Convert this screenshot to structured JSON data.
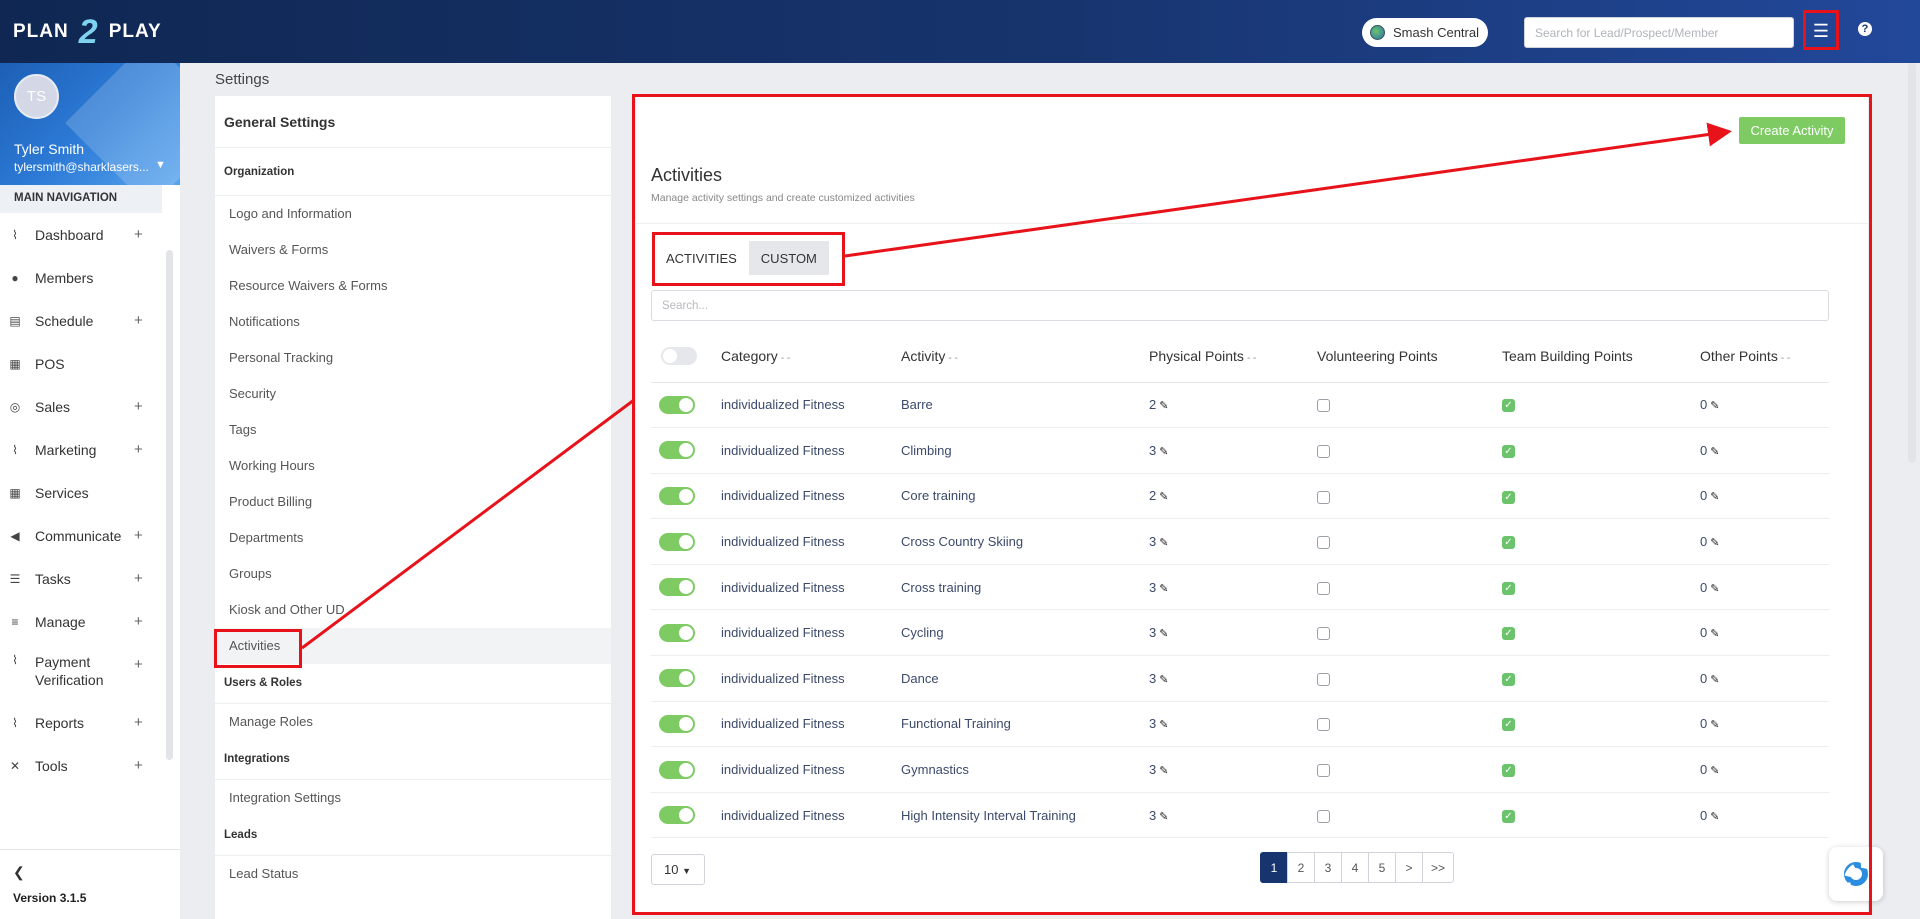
{
  "brand": {
    "part1": "PLAN",
    "part2": "2",
    "part3": "PLAY"
  },
  "header": {
    "location": "Smash Central",
    "search_placeholder": "Search for Lead/Prospect/Member",
    "menu_icon": "hamburger-menu-icon",
    "help_icon": "question-icon"
  },
  "profile": {
    "initials": "TS",
    "name": "Tyler Smith",
    "email": "tylersmith@sharklasers..."
  },
  "nav": {
    "title": "MAIN NAVIGATION",
    "items": [
      {
        "label": "Dashboard",
        "icon": "chart-line-icon",
        "expandable": true
      },
      {
        "label": "Members",
        "icon": "users-icon",
        "expandable": false
      },
      {
        "label": "Schedule",
        "icon": "calendar-icon",
        "expandable": true
      },
      {
        "label": "POS",
        "icon": "grid-icon",
        "expandable": false
      },
      {
        "label": "Sales",
        "icon": "target-icon",
        "expandable": true
      },
      {
        "label": "Marketing",
        "icon": "chart-line-icon",
        "expandable": true
      },
      {
        "label": "Services",
        "icon": "grid-icon",
        "expandable": false
      },
      {
        "label": "Communicate",
        "icon": "megaphone-icon",
        "expandable": true
      },
      {
        "label": "Tasks",
        "icon": "list-icon",
        "expandable": true
      },
      {
        "label": "Manage",
        "icon": "bars-icon",
        "expandable": true
      },
      {
        "label": "Payment Verification",
        "icon": "chart-line-icon",
        "expandable": true
      },
      {
        "label": "Reports",
        "icon": "chart-line-icon",
        "expandable": true
      },
      {
        "label": "Tools",
        "icon": "tools-icon",
        "expandable": true
      }
    ],
    "version": "Version 3.1.5"
  },
  "page": {
    "title": "Settings"
  },
  "settings_menu": {
    "heading": "General Settings",
    "organization_label": "Organization",
    "organization_items": [
      "Logo and Information",
      "Waivers & Forms",
      "Resource Waivers & Forms",
      "Notifications",
      "Personal Tracking",
      "Security",
      "Tags",
      "Working Hours",
      "Product Billing",
      "Departments",
      "Groups",
      "Kiosk and Other UD",
      "Activities"
    ],
    "users_label": "Users & Roles",
    "users_items": [
      "Manage Roles"
    ],
    "integrations_label": "Integrations",
    "integrations_items": [
      "Integration Settings"
    ],
    "leads_label": "Leads",
    "leads_items": [
      "Lead Status"
    ]
  },
  "activities": {
    "create_label": "Create Activity",
    "title": "Activities",
    "subtitle": "Manage activity settings and create customized activities",
    "tabs": [
      "ACTIVITIES",
      "CUSTOM"
    ],
    "search_placeholder": "Search...",
    "columns": [
      "Category",
      "Activity",
      "Physical Points",
      "Volunteering Points",
      "Team Building Points",
      "Other Points"
    ],
    "sort_indicator": "- -",
    "rows": [
      {
        "category": "individualized Fitness",
        "activity": "Barre",
        "physical": "2",
        "volunteering": false,
        "team": true,
        "other": "0"
      },
      {
        "category": "individualized Fitness",
        "activity": "Climbing",
        "physical": "3",
        "volunteering": false,
        "team": true,
        "other": "0"
      },
      {
        "category": "individualized Fitness",
        "activity": "Core training",
        "physical": "2",
        "volunteering": false,
        "team": true,
        "other": "0"
      },
      {
        "category": "individualized Fitness",
        "activity": "Cross Country Skiing",
        "physical": "3",
        "volunteering": false,
        "team": true,
        "other": "0"
      },
      {
        "category": "individualized Fitness",
        "activity": "Cross training",
        "physical": "3",
        "volunteering": false,
        "team": true,
        "other": "0"
      },
      {
        "category": "individualized Fitness",
        "activity": "Cycling",
        "physical": "3",
        "volunteering": false,
        "team": true,
        "other": "0"
      },
      {
        "category": "individualized Fitness",
        "activity": "Dance",
        "physical": "3",
        "volunteering": false,
        "team": true,
        "other": "0"
      },
      {
        "category": "individualized Fitness",
        "activity": "Functional Training",
        "physical": "3",
        "volunteering": false,
        "team": true,
        "other": "0"
      },
      {
        "category": "individualized Fitness",
        "activity": "Gymnastics",
        "physical": "3",
        "volunteering": false,
        "team": true,
        "other": "0"
      },
      {
        "category": "individualized Fitness",
        "activity": "High Intensity Interval Training",
        "physical": "3",
        "volunteering": false,
        "team": true,
        "other": "0"
      }
    ],
    "page_size": "10",
    "pages": [
      "1",
      "2",
      "3",
      "4",
      "5",
      ">",
      ">>"
    ],
    "current_page": "1"
  },
  "colors": {
    "topbar": "#17346e",
    "accent_green": "#7ecb63",
    "annotation_red": "#e8131a"
  }
}
